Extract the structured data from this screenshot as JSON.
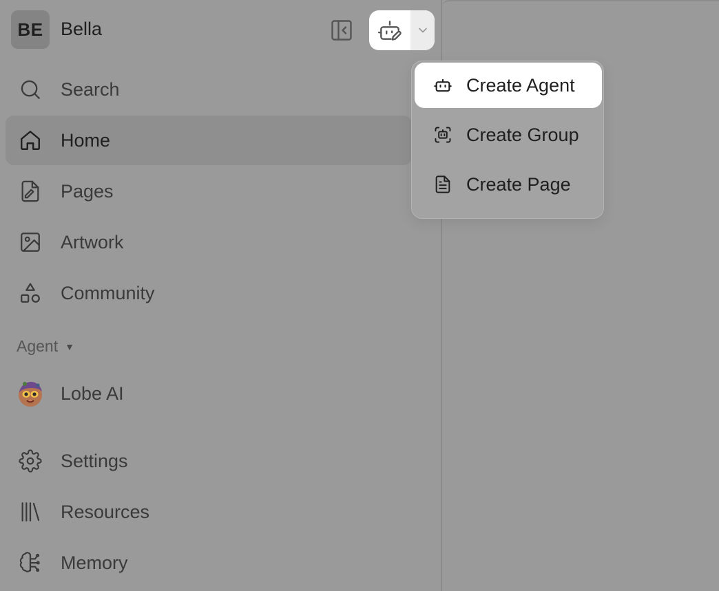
{
  "user": {
    "initials": "BE",
    "name": "Bella"
  },
  "nav": {
    "items": [
      {
        "key": "search",
        "label": "Search",
        "icon": "search-icon"
      },
      {
        "key": "home",
        "label": "Home",
        "icon": "home-icon",
        "active": true
      },
      {
        "key": "pages",
        "label": "Pages",
        "icon": "pages-icon"
      },
      {
        "key": "artwork",
        "label": "Artwork",
        "icon": "image-icon"
      },
      {
        "key": "community",
        "label": "Community",
        "icon": "shapes-icon"
      }
    ]
  },
  "agent_section": {
    "header": "Agent",
    "agents": [
      {
        "label": "Lobe AI",
        "icon": "lobe-ai-avatar"
      }
    ]
  },
  "bottom_nav": {
    "items": [
      {
        "key": "settings",
        "label": "Settings",
        "icon": "gear-icon"
      },
      {
        "key": "resources",
        "label": "Resources",
        "icon": "library-icon"
      },
      {
        "key": "memory",
        "label": "Memory",
        "icon": "brain-icon"
      }
    ]
  },
  "dropdown": {
    "items": [
      {
        "label": "Create Agent",
        "icon": "bot-icon",
        "highlighted": true
      },
      {
        "label": "Create Group",
        "icon": "bot-group-icon"
      },
      {
        "label": "Create Page",
        "icon": "document-icon"
      }
    ]
  },
  "colors": {
    "overlay_background": "#9a9a9a",
    "highlight": "#ffffff",
    "text_primary": "#1f1f1f",
    "text_secondary": "#3a3a3a"
  }
}
